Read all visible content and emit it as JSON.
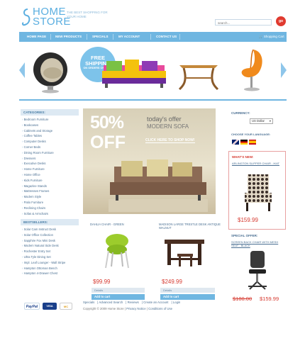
{
  "brand": {
    "name_line1": "HOME",
    "name_line2": "STORE",
    "tagline": "THE BEST SHOPPING FOR YOUR HOME"
  },
  "search": {
    "placeholder": "search...",
    "go_label": "go"
  },
  "nav": {
    "items": [
      "HOME PAGE",
      "NEW PRODUCTS",
      "SPECIALS",
      "MY ACCOUNT",
      "CONTACT US"
    ],
    "cart_label": "Shopping Cart",
    "cart_count": "(0 items)"
  },
  "banner": {
    "badge_line1": "FREE",
    "badge_line2": "SHIPPING",
    "badge_line3": "ON ORDERS OF $150+"
  },
  "categories": {
    "title": "CATEGORIES:",
    "items": [
      "Bedroom Furniture",
      "Bookcases",
      "Cabinets and Storage",
      "Coffee Tables",
      "Computer Desks",
      "Corner Beds",
      "Dining Room Furniture",
      "Dressers",
      "Executive Desks",
      "Home Furniture",
      "Home Office",
      "Kids Furniture",
      "Magazine Stands",
      "Mattresses Frames",
      "Modern Style",
      "Patio Furniture",
      "Reclining Chairs",
      "Sofas & Armchairs"
    ]
  },
  "bestsellers": {
    "title": "BESTSELLERS:",
    "items": [
      "Solar Cam Instruct Desk",
      "Solar Office Collection",
      "Sapphire Fox Mini Desk",
      "Modern Natural Side Desk",
      "Rochester Entry Set",
      "Ultra Tyle Dining Set",
      "Impl. Leaf Lounger - Wall Stripe",
      "Hampton Ottoman Bench",
      "Hampton 4-Drawer Chest"
    ]
  },
  "hero": {
    "percent": "50%",
    "off": "OFF",
    "line1": "today's offer",
    "line2": "MODERN SOFA",
    "cta": "CLICK HERE TO SHOP NOW!"
  },
  "products": [
    {
      "title": "DAHLIA CHAIR - GREEN",
      "price": "$99.99",
      "details": "Details",
      "add": "Add to cart"
    },
    {
      "title": "MADISON LARGE TRESTLE DESK ANTIQUE WALNUT",
      "price": "$249.99",
      "details": "Details",
      "add": "Add to cart"
    }
  ],
  "right": {
    "currency_title": "CURRENCY:",
    "currency_value": "US Dollar",
    "language_title": "CHOOSE YOUR LANGUAGE:",
    "whatsnew_title": "WHAT'S NEW:",
    "whatsnew_product": "ARLINGTON SLIPPER CHAIR - IKAT",
    "whatsnew_price": "$159.99",
    "special_title": "SPECIAL OFFER:",
    "special_product": "SCREEN BACK CHAIR WITH MESH SEAT - BLACK",
    "special_old_price": "$180.00",
    "special_new_price": "$159.99"
  },
  "footer": {
    "links": [
      "Specials",
      "Advanced Search",
      "Reviews",
      "Create an Account",
      "Login"
    ],
    "copyright": "Copyright © 2009 Home Store",
    "links2": [
      "Privacy Notice",
      "Conditions of Use"
    ],
    "pay": [
      "PayPal",
      "VISA",
      "MC"
    ]
  },
  "colors": {
    "accent": "#6fb6e1",
    "price": "#d63a30",
    "go": "#e03a2f"
  }
}
